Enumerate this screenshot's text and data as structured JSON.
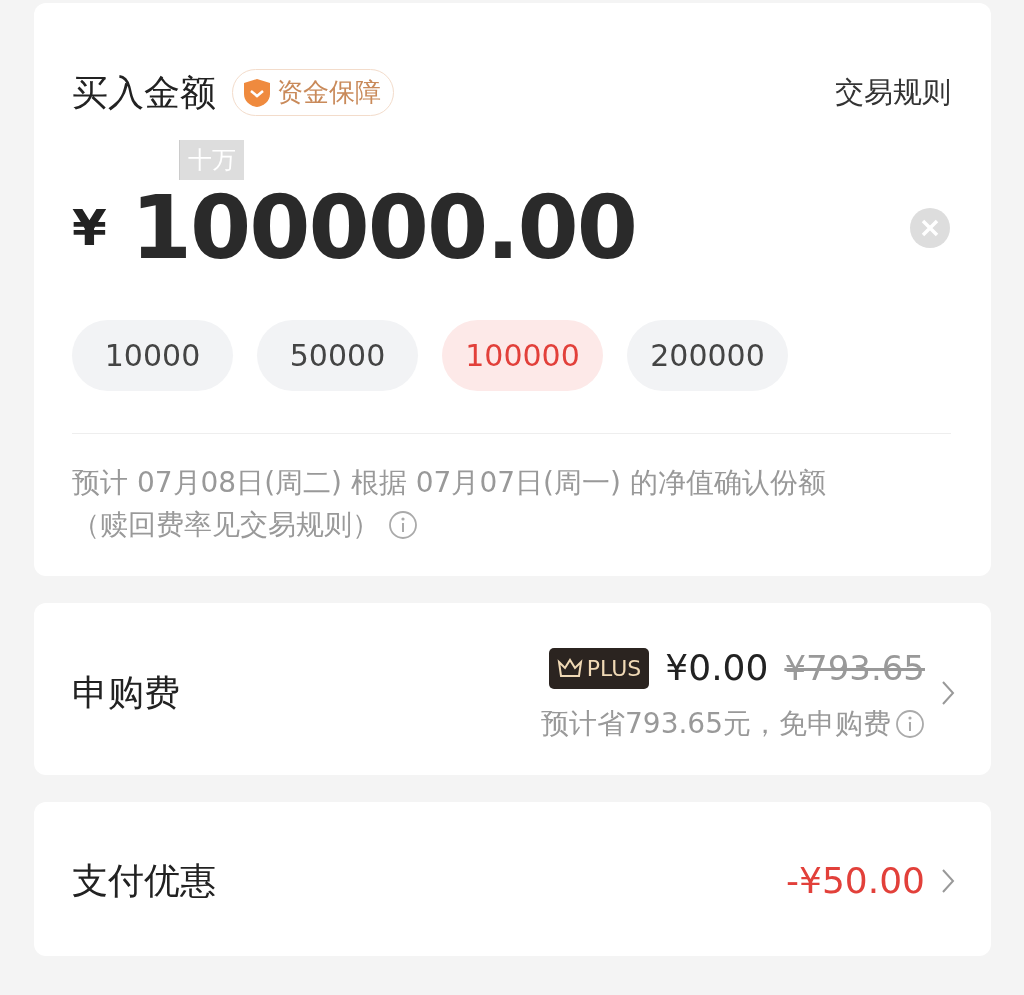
{
  "header": {
    "title": "买入金额",
    "badge": "资金保障",
    "link": "交易规则"
  },
  "amount": {
    "unit_hint": "十万",
    "currency": "¥",
    "value": "100000.00"
  },
  "presets": [
    {
      "label": "10000",
      "selected": false
    },
    {
      "label": "50000",
      "selected": false
    },
    {
      "label": "100000",
      "selected": true
    },
    {
      "label": "200000",
      "selected": false
    }
  ],
  "note": {
    "line": "预计 07月08日(周二) 根据 07月07日(周一) 的净值确认份额",
    "sub": "（赎回费率见交易规则）"
  },
  "fee": {
    "label": "申购费",
    "badge": "PLUS",
    "price": "¥0.00",
    "original_price": "¥793.65",
    "hint": "预计省793.65元，免申购费"
  },
  "discount": {
    "label": "支付优惠",
    "value": "-¥50.00"
  }
}
